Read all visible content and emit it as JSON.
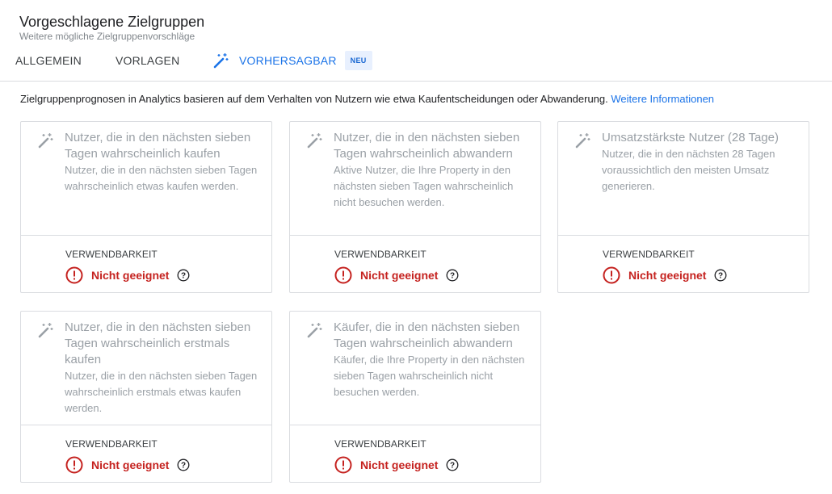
{
  "header": {
    "title": "Vorgeschlagene Zielgruppen",
    "subtitle": "Weitere mögliche Zielgruppenvorschläge"
  },
  "tabs": [
    {
      "label": "ALLGEMEIN",
      "active": false
    },
    {
      "label": "VORLAGEN",
      "active": false
    },
    {
      "label": "VORHERSAGBAR",
      "active": true,
      "icon": "magic-wand-icon",
      "badge": "NEU"
    }
  ],
  "intro": {
    "text": "Zielgruppenprognosen in Analytics basieren auf dem Verhalten von Nutzern wie etwa Kaufentscheidungen oder Abwanderung. ",
    "link": "Weitere Informationen"
  },
  "cards": [
    {
      "title": "Nutzer, die in den nächsten sieben Tagen wahrscheinlich kaufen",
      "description": "Nutzer, die in den nächsten sieben Tagen wahrscheinlich etwas kaufen werden.",
      "usability_label": "VERWENDBARKEIT",
      "status": "Nicht geeignet"
    },
    {
      "title": "Nutzer, die in den nächsten sieben Tagen wahrscheinlich abwandern",
      "description": "Aktive Nutzer, die Ihre Property in den nächsten sieben Tagen wahrscheinlich nicht besuchen werden.",
      "usability_label": "VERWENDBARKEIT",
      "status": "Nicht geeignet"
    },
    {
      "title": "Umsatzstärkste Nutzer (28 Tage)",
      "description": "Nutzer, die in den nächsten 28 Tagen voraussichtlich den meisten Umsatz generieren.",
      "usability_label": "VERWENDBARKEIT",
      "status": "Nicht geeignet"
    },
    {
      "title": "Nutzer, die in den nächsten sieben Tagen wahrscheinlich erstmals kaufen",
      "description": "Nutzer, die in den nächsten sieben Tagen wahrscheinlich erstmals etwas kaufen werden.",
      "usability_label": "VERWENDBARKEIT",
      "status": "Nicht geeignet"
    },
    {
      "title": "Käufer, die in den nächsten sieben Tagen wahrscheinlich abwandern",
      "description": "Käufer, die Ihre Property in den nächsten sieben Tagen wahrscheinlich nicht besuchen werden.",
      "usability_label": "VERWENDBARKEIT",
      "status": "Nicht geeignet"
    }
  ],
  "colors": {
    "accent": "#1a73e8",
    "error": "#c5221f",
    "muted": "#9aa0a6",
    "border": "#dadce0"
  }
}
